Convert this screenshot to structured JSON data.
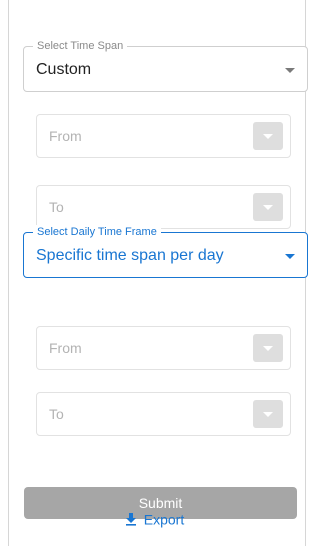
{
  "time_span": {
    "legend": "Select Time Span",
    "value": "Custom"
  },
  "span_range": {
    "from_placeholder": "From",
    "to_placeholder": "To"
  },
  "daily_frame": {
    "legend": "Select Daily Time Frame",
    "value": "Specific time span per day",
    "accent": "#1976d2"
  },
  "daily_range": {
    "from_placeholder": "From",
    "to_placeholder": "To"
  },
  "actions": {
    "submit_label": "Submit",
    "export_label": "Export",
    "export_icon": "download-icon"
  }
}
